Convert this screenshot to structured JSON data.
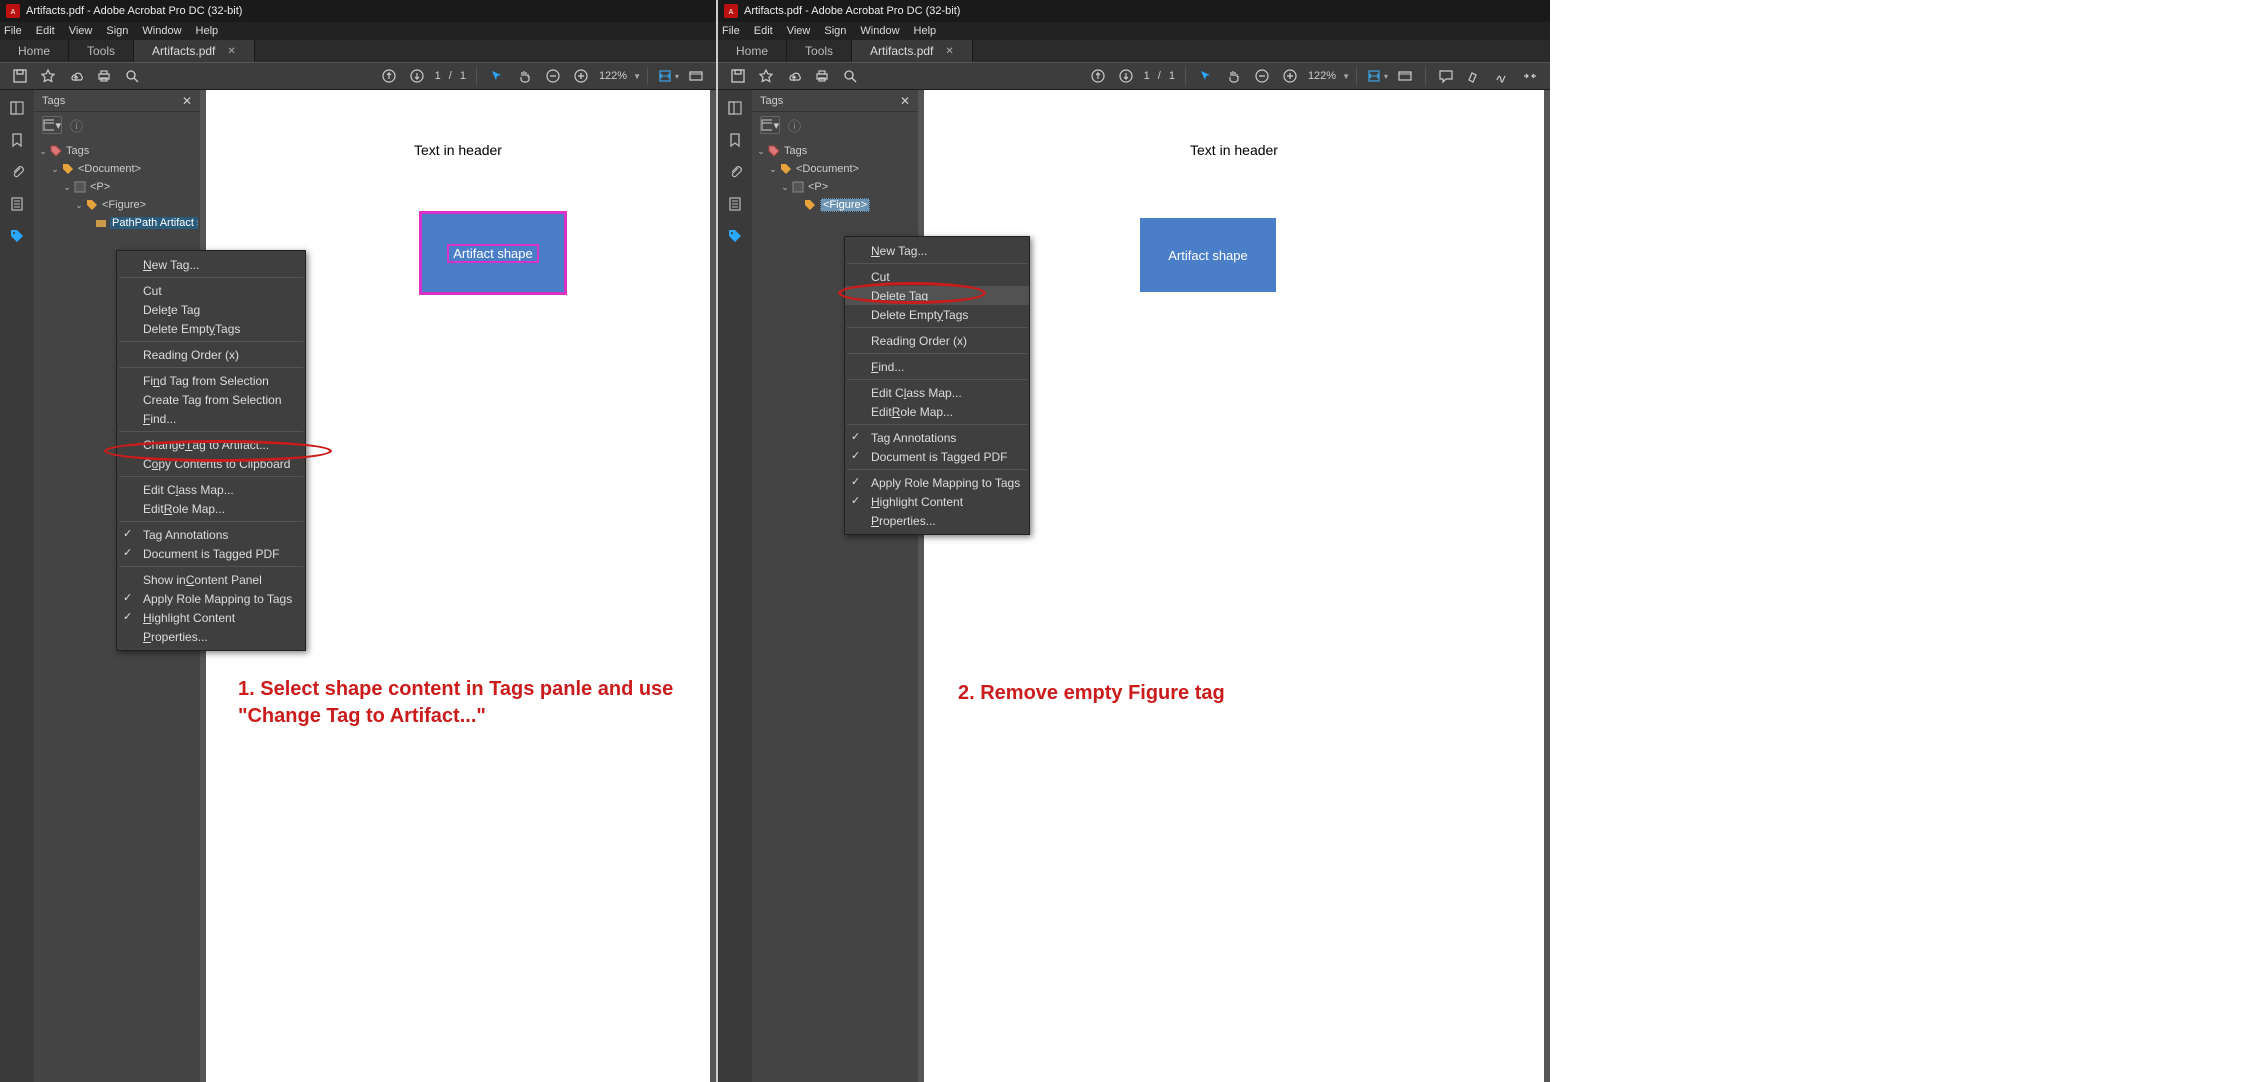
{
  "app": {
    "title": "Artifacts.pdf - Adobe Acrobat Pro DC (32-bit)"
  },
  "menubar": [
    "File",
    "Edit",
    "View",
    "Sign",
    "Window",
    "Help"
  ],
  "tabs": {
    "home": "Home",
    "tools": "Tools",
    "doc": "Artifacts.pdf"
  },
  "toolbar": {
    "page_cur": "1",
    "page_sep": "/",
    "page_total": "1",
    "zoom": "122%"
  },
  "tags_panel": {
    "title": "Tags",
    "tree": {
      "root": "Tags",
      "doc": "<Document>",
      "p": "<P>",
      "figure": "<Figure>",
      "path": "PathPath Artifact shape"
    }
  },
  "document": {
    "header_text": "Text in header",
    "shape_label": "Artifact shape"
  },
  "ctx_left": [
    {
      "t": "item",
      "label": "New Tag...",
      "u": "N"
    },
    {
      "t": "sep"
    },
    {
      "t": "item",
      "label": "Cut",
      "u": ""
    },
    {
      "t": "item",
      "label": "Delete Tag",
      "u": "T"
    },
    {
      "t": "item",
      "label": "Delete Empty Tags",
      "u": "y"
    },
    {
      "t": "sep"
    },
    {
      "t": "item",
      "label": "Reading Order (x)",
      "u": ""
    },
    {
      "t": "sep"
    },
    {
      "t": "item",
      "label": "Find Tag from Selection",
      "u": "n"
    },
    {
      "t": "item",
      "label": "Create Tag from Selection",
      "u": ""
    },
    {
      "t": "item",
      "label": "Find...",
      "u": "F"
    },
    {
      "t": "sep"
    },
    {
      "t": "item",
      "label": "Change Tag to Artifact...",
      "u": "T"
    },
    {
      "t": "item",
      "label": "Copy Contents to Clipboard",
      "u": "o"
    },
    {
      "t": "sep"
    },
    {
      "t": "item",
      "label": "Edit Class Map...",
      "u": "l"
    },
    {
      "t": "item",
      "label": "Edit Role Map...",
      "u": "R"
    },
    {
      "t": "sep"
    },
    {
      "t": "item",
      "label": "Tag Annotations",
      "u": "",
      "chk": true
    },
    {
      "t": "item",
      "label": "Document is Tagged PDF",
      "u": "",
      "chk": true
    },
    {
      "t": "sep"
    },
    {
      "t": "item",
      "label": "Show in Content Panel",
      "u": "C"
    },
    {
      "t": "item",
      "label": "Apply Role Mapping to Tags",
      "u": "",
      "chk": true
    },
    {
      "t": "item",
      "label": "Highlight Content",
      "u": "H",
      "chk": true
    },
    {
      "t": "item",
      "label": "Properties...",
      "u": "P"
    }
  ],
  "ctx_right": [
    {
      "t": "item",
      "label": "New Tag...",
      "u": "N"
    },
    {
      "t": "sep"
    },
    {
      "t": "item",
      "label": "Cut",
      "u": ""
    },
    {
      "t": "item",
      "label": "Delete Tag",
      "u": "T",
      "hov": true
    },
    {
      "t": "item",
      "label": "Delete Empty Tags",
      "u": "y"
    },
    {
      "t": "sep"
    },
    {
      "t": "item",
      "label": "Reading Order (x)",
      "u": ""
    },
    {
      "t": "sep"
    },
    {
      "t": "item",
      "label": "Find...",
      "u": "F"
    },
    {
      "t": "sep"
    },
    {
      "t": "item",
      "label": "Edit Class Map...",
      "u": "l"
    },
    {
      "t": "item",
      "label": "Edit Role Map...",
      "u": "R"
    },
    {
      "t": "sep"
    },
    {
      "t": "item",
      "label": "Tag Annotations",
      "u": "",
      "chk": true
    },
    {
      "t": "item",
      "label": "Document is Tagged PDF",
      "u": "",
      "chk": true
    },
    {
      "t": "sep"
    },
    {
      "t": "item",
      "label": "Apply Role Mapping to Tags",
      "u": "",
      "chk": true
    },
    {
      "t": "item",
      "label": "Highlight Content",
      "u": "H",
      "chk": true
    },
    {
      "t": "item",
      "label": "Properties...",
      "u": "P"
    }
  ],
  "annotations": {
    "left": "1. Select shape content in Tags panle and use \"Change Tag to Artifact...\"",
    "right": "2. Remove empty Figure tag"
  }
}
